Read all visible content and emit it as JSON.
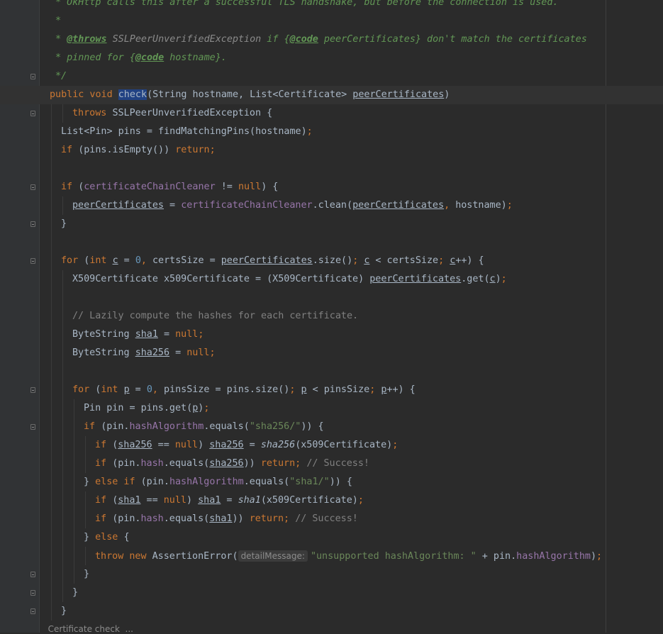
{
  "editor": {
    "language": "java",
    "caret_symbol": "check",
    "right_margin_visible": true,
    "colors": {
      "background": "#2b2b2b",
      "gutter": "#313335",
      "keyword": "#cc7832",
      "field": "#9876aa",
      "string": "#6a8759",
      "number": "#6897bb",
      "comment": "#808080",
      "doc_comment": "#629755",
      "identifier_highlight": "#214283"
    }
  },
  "lines": [
    {
      "indent": 0.5,
      "tokens": [
        {
          "t": "* OkHttp calls this after a successful TLS handshake, but before the connection is used.",
          "k": "cd"
        }
      ]
    },
    {
      "indent": 0.5,
      "tokens": [
        {
          "t": "*",
          "k": "cd"
        }
      ]
    },
    {
      "indent": 0.5,
      "tokens": [
        {
          "t": "* ",
          "k": "cd"
        },
        {
          "t": "@throws",
          "k": "ct"
        },
        {
          "t": " SSLPeerUnverifiedException",
          "k": "cc"
        },
        {
          "t": " if {",
          "k": "cd"
        },
        {
          "t": "@code",
          "k": "ct"
        },
        {
          "t": " peerCertificates} don't match the certificates",
          "k": "cd"
        }
      ]
    },
    {
      "indent": 0.5,
      "tokens": [
        {
          "t": "* pinned for {",
          "k": "cd"
        },
        {
          "t": "@code",
          "k": "ct"
        },
        {
          "t": " hostname}.",
          "k": "cd"
        }
      ]
    },
    {
      "indent": 0.5,
      "fold": true,
      "tokens": [
        {
          "t": "*/",
          "k": "cd"
        }
      ]
    },
    {
      "indent": 0,
      "current": true,
      "tokens": [
        {
          "t": "public void ",
          "k": "k"
        },
        {
          "t": "check",
          "k": "hl"
        },
        {
          "t": "(String hostname, List<Certificate> ",
          "k": "d"
        },
        {
          "t": "peerCertificates",
          "k": "u"
        },
        {
          "t": ")",
          "k": "d"
        }
      ]
    },
    {
      "indent": 2,
      "fold": true,
      "tokens": [
        {
          "t": "throws ",
          "k": "k"
        },
        {
          "t": "SSLPeerUnverifiedException {",
          "k": "d"
        }
      ]
    },
    {
      "indent": 1,
      "tokens": [
        {
          "t": "List<Pin> pins = findMatchingPins(hostname)",
          "k": "d"
        },
        {
          "t": ";",
          "k": "k"
        }
      ]
    },
    {
      "indent": 1,
      "tokens": [
        {
          "t": "if ",
          "k": "k"
        },
        {
          "t": "(pins.isEmpty()) ",
          "k": "d"
        },
        {
          "t": "return;",
          "k": "k"
        }
      ]
    },
    {
      "indent": 1,
      "tokens": []
    },
    {
      "indent": 1,
      "fold": true,
      "tokens": [
        {
          "t": "if ",
          "k": "k"
        },
        {
          "t": "(",
          "k": "d"
        },
        {
          "t": "certificateChainCleaner",
          "k": "f"
        },
        {
          "t": " != ",
          "k": "d"
        },
        {
          "t": "null",
          "k": "k"
        },
        {
          "t": ") {",
          "k": "d"
        }
      ]
    },
    {
      "indent": 2,
      "tokens": [
        {
          "t": "peerCertificates",
          "k": "u"
        },
        {
          "t": " = ",
          "k": "d"
        },
        {
          "t": "certificateChainCleaner",
          "k": "f"
        },
        {
          "t": ".clean(",
          "k": "d"
        },
        {
          "t": "peerCertificates",
          "k": "u"
        },
        {
          "t": ", ",
          "k": "k"
        },
        {
          "t": "hostname)",
          "k": "d"
        },
        {
          "t": ";",
          "k": "k"
        }
      ]
    },
    {
      "indent": 1,
      "fold": true,
      "tokens": [
        {
          "t": "}",
          "k": "d"
        }
      ]
    },
    {
      "indent": 1,
      "tokens": []
    },
    {
      "indent": 1,
      "fold": true,
      "tokens": [
        {
          "t": "for ",
          "k": "k"
        },
        {
          "t": "(",
          "k": "d"
        },
        {
          "t": "int ",
          "k": "k"
        },
        {
          "t": "c",
          "k": "u"
        },
        {
          "t": " = ",
          "k": "d"
        },
        {
          "t": "0",
          "k": "n"
        },
        {
          "t": ", ",
          "k": "k"
        },
        {
          "t": "certsSize = ",
          "k": "d"
        },
        {
          "t": "peerCertificates",
          "k": "u"
        },
        {
          "t": ".size()",
          "k": "d"
        },
        {
          "t": "; ",
          "k": "k"
        },
        {
          "t": "c",
          "k": "u"
        },
        {
          "t": " < certsSize",
          "k": "d"
        },
        {
          "t": "; ",
          "k": "k"
        },
        {
          "t": "c",
          "k": "u"
        },
        {
          "t": "++) {",
          "k": "d"
        }
      ]
    },
    {
      "indent": 2,
      "tokens": [
        {
          "t": "X509Certificate x509Certificate = (X509Certificate) ",
          "k": "d"
        },
        {
          "t": "peerCertificates",
          "k": "u"
        },
        {
          "t": ".get(",
          "k": "d"
        },
        {
          "t": "c",
          "k": "u"
        },
        {
          "t": ")",
          "k": "d"
        },
        {
          "t": ";",
          "k": "k"
        }
      ]
    },
    {
      "indent": 2,
      "tokens": []
    },
    {
      "indent": 2,
      "tokens": [
        {
          "t": "// Lazily compute the hashes for each certificate.",
          "k": "c"
        }
      ]
    },
    {
      "indent": 2,
      "tokens": [
        {
          "t": "ByteString ",
          "k": "d"
        },
        {
          "t": "sha1",
          "k": "u"
        },
        {
          "t": " = ",
          "k": "d"
        },
        {
          "t": "null;",
          "k": "k"
        }
      ]
    },
    {
      "indent": 2,
      "tokens": [
        {
          "t": "ByteString ",
          "k": "d"
        },
        {
          "t": "sha256",
          "k": "u"
        },
        {
          "t": " = ",
          "k": "d"
        },
        {
          "t": "null;",
          "k": "k"
        }
      ]
    },
    {
      "indent": 2,
      "tokens": []
    },
    {
      "indent": 2,
      "fold": true,
      "tokens": [
        {
          "t": "for ",
          "k": "k"
        },
        {
          "t": "(",
          "k": "d"
        },
        {
          "t": "int ",
          "k": "k"
        },
        {
          "t": "p",
          "k": "u"
        },
        {
          "t": " = ",
          "k": "d"
        },
        {
          "t": "0",
          "k": "n"
        },
        {
          "t": ", ",
          "k": "k"
        },
        {
          "t": "pinsSize = pins.size()",
          "k": "d"
        },
        {
          "t": "; ",
          "k": "k"
        },
        {
          "t": "p",
          "k": "u"
        },
        {
          "t": " < pinsSize",
          "k": "d"
        },
        {
          "t": "; ",
          "k": "k"
        },
        {
          "t": "p",
          "k": "u"
        },
        {
          "t": "++) {",
          "k": "d"
        }
      ]
    },
    {
      "indent": 3,
      "tokens": [
        {
          "t": "Pin pin = pins.get(",
          "k": "d"
        },
        {
          "t": "p",
          "k": "u"
        },
        {
          "t": ")",
          "k": "d"
        },
        {
          "t": ";",
          "k": "k"
        }
      ]
    },
    {
      "indent": 3,
      "fold": true,
      "tokens": [
        {
          "t": "if ",
          "k": "k"
        },
        {
          "t": "(pin.",
          "k": "d"
        },
        {
          "t": "hashAlgorithm",
          "k": "f"
        },
        {
          "t": ".equals(",
          "k": "d"
        },
        {
          "t": "\"sha256/\"",
          "k": "s"
        },
        {
          "t": ")) {",
          "k": "d"
        }
      ]
    },
    {
      "indent": 4,
      "tokens": [
        {
          "t": "if ",
          "k": "k"
        },
        {
          "t": "(",
          "k": "d"
        },
        {
          "t": "sha256",
          "k": "u"
        },
        {
          "t": " == ",
          "k": "d"
        },
        {
          "t": "null",
          "k": "k"
        },
        {
          "t": ") ",
          "k": "d"
        },
        {
          "t": "sha256",
          "k": "u"
        },
        {
          "t": " = ",
          "k": "d"
        },
        {
          "t": "sha256",
          "k": "i"
        },
        {
          "t": "(x509Certificate)",
          "k": "d"
        },
        {
          "t": ";",
          "k": "k"
        }
      ]
    },
    {
      "indent": 4,
      "tokens": [
        {
          "t": "if ",
          "k": "k"
        },
        {
          "t": "(pin.",
          "k": "d"
        },
        {
          "t": "hash",
          "k": "f"
        },
        {
          "t": ".equals(",
          "k": "d"
        },
        {
          "t": "sha256",
          "k": "u"
        },
        {
          "t": ")) ",
          "k": "d"
        },
        {
          "t": "return; ",
          "k": "k"
        },
        {
          "t": "// Success!",
          "k": "c"
        }
      ]
    },
    {
      "indent": 3,
      "tokens": [
        {
          "t": "} ",
          "k": "d"
        },
        {
          "t": "else if ",
          "k": "k"
        },
        {
          "t": "(pin.",
          "k": "d"
        },
        {
          "t": "hashAlgorithm",
          "k": "f"
        },
        {
          "t": ".equals(",
          "k": "d"
        },
        {
          "t": "\"sha1/\"",
          "k": "s"
        },
        {
          "t": ")) {",
          "k": "d"
        }
      ]
    },
    {
      "indent": 4,
      "tokens": [
        {
          "t": "if ",
          "k": "k"
        },
        {
          "t": "(",
          "k": "d"
        },
        {
          "t": "sha1",
          "k": "u"
        },
        {
          "t": " == ",
          "k": "d"
        },
        {
          "t": "null",
          "k": "k"
        },
        {
          "t": ") ",
          "k": "d"
        },
        {
          "t": "sha1",
          "k": "u"
        },
        {
          "t": " = ",
          "k": "d"
        },
        {
          "t": "sha1",
          "k": "i"
        },
        {
          "t": "(x509Certificate)",
          "k": "d"
        },
        {
          "t": ";",
          "k": "k"
        }
      ]
    },
    {
      "indent": 4,
      "tokens": [
        {
          "t": "if ",
          "k": "k"
        },
        {
          "t": "(pin.",
          "k": "d"
        },
        {
          "t": "hash",
          "k": "f"
        },
        {
          "t": ".equals(",
          "k": "d"
        },
        {
          "t": "sha1",
          "k": "u"
        },
        {
          "t": ")) ",
          "k": "d"
        },
        {
          "t": "return; ",
          "k": "k"
        },
        {
          "t": "// Success!",
          "k": "c"
        }
      ]
    },
    {
      "indent": 3,
      "tokens": [
        {
          "t": "} ",
          "k": "d"
        },
        {
          "t": "else ",
          "k": "k"
        },
        {
          "t": "{",
          "k": "d"
        }
      ]
    },
    {
      "indent": 4,
      "tokens": [
        {
          "t": "throw new ",
          "k": "k"
        },
        {
          "t": "AssertionError(",
          "k": "d"
        },
        {
          "t": "detailMessage:",
          "k": "hint"
        },
        {
          "t": "\"unsupported hashAlgorithm: \"",
          "k": "s"
        },
        {
          "t": " + pin.",
          "k": "d"
        },
        {
          "t": "hashAlgorithm",
          "k": "f"
        },
        {
          "t": ")",
          "k": "d"
        },
        {
          "t": ";",
          "k": "k"
        }
      ]
    },
    {
      "indent": 3,
      "fold": true,
      "tokens": [
        {
          "t": "}",
          "k": "d"
        }
      ]
    },
    {
      "indent": 2,
      "fold": true,
      "tokens": [
        {
          "t": "}",
          "k": "d"
        }
      ]
    },
    {
      "indent": 1,
      "fold": true,
      "tokens": [
        {
          "t": "}",
          "k": "d"
        }
      ]
    }
  ],
  "status_peek": "  Certificate check  ..."
}
